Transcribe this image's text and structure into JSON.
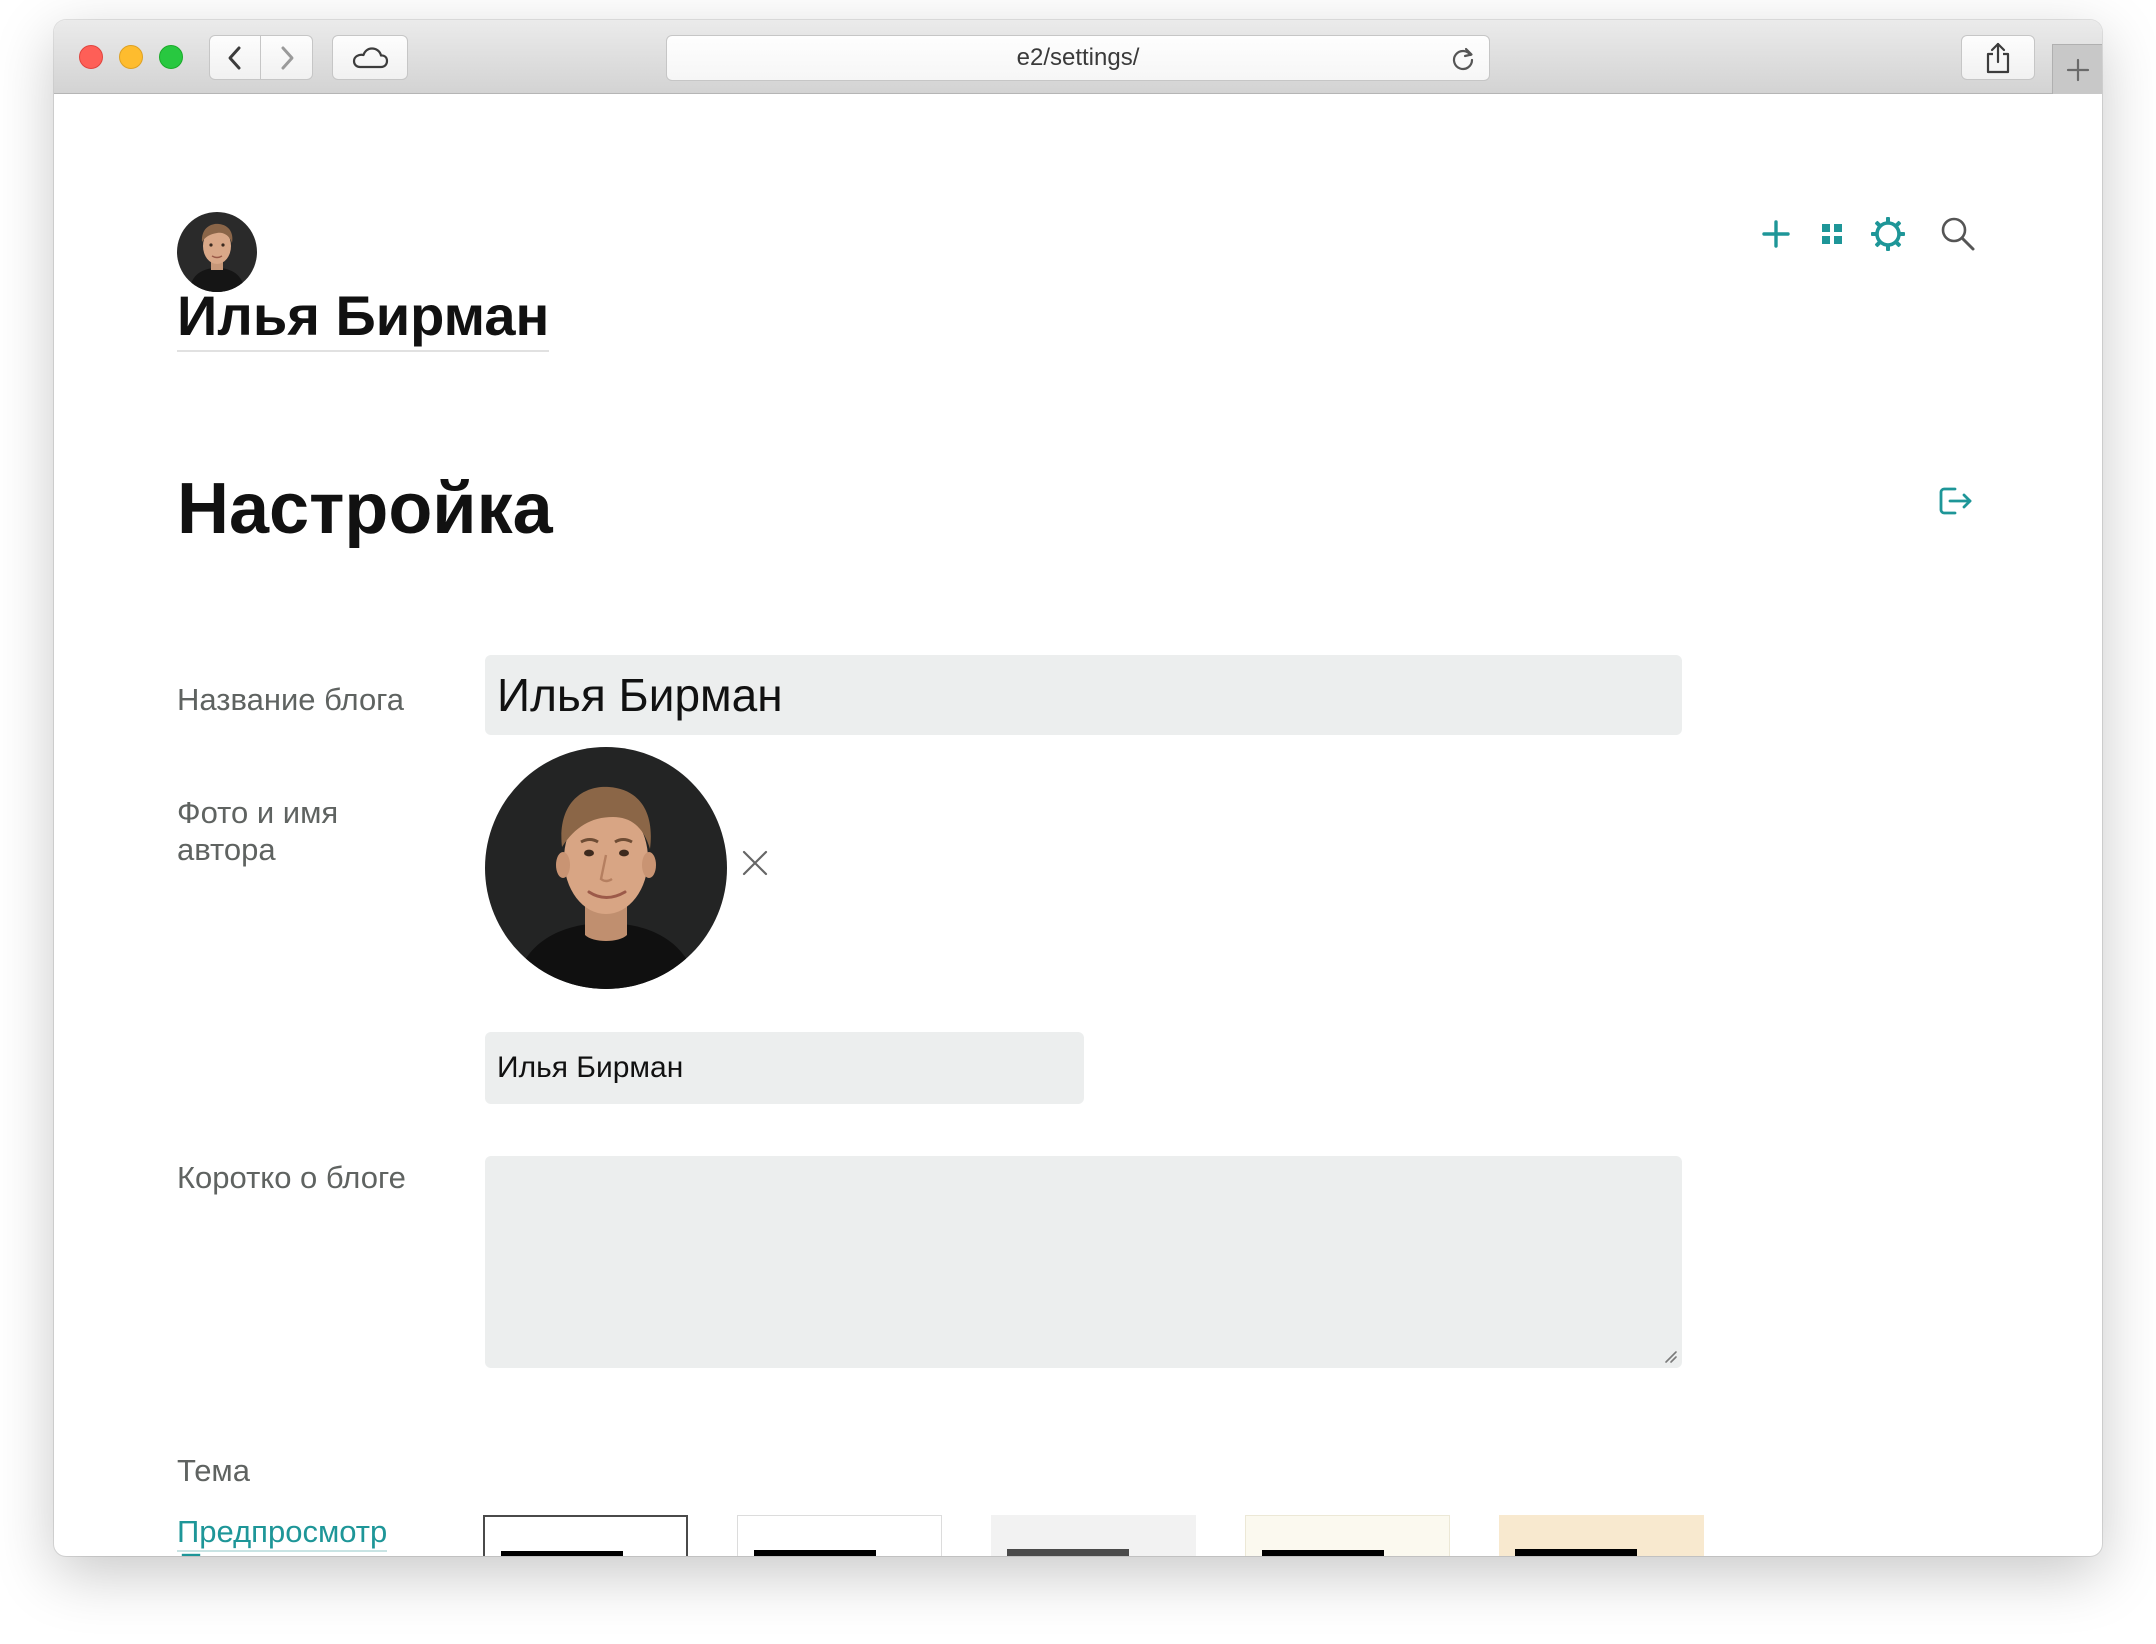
{
  "browser": {
    "url": "e2/settings/",
    "icons": {
      "back": "chevron-left-icon",
      "forward": "chevron-right-icon",
      "cloud": "cloud-icon",
      "reload": "reload-icon",
      "share": "share-icon",
      "new_tab": "plus-icon"
    }
  },
  "header": {
    "blog_title": "Илья Бирман",
    "actions": [
      "plus-icon",
      "grid-icon",
      "gear-icon",
      "search-icon"
    ],
    "accent_color": "#1e9698"
  },
  "page": {
    "title": "Настройка",
    "logout_icon": "logout-icon"
  },
  "form": {
    "blog_name": {
      "label": "Название блога",
      "value": "Илья Бирман"
    },
    "author": {
      "label_line1": "Фото и имя",
      "label_line2": "автора",
      "name_value": "Илья Бирман",
      "remove_icon": "close-icon"
    },
    "about": {
      "label": "Коротко о блоге",
      "value": ""
    },
    "theme": {
      "label": "Тема",
      "preview_link": "Предпросмотр",
      "selected_index": 0,
      "options": [
        {
          "background": "#ffffff"
        },
        {
          "background": "#ffffff"
        },
        {
          "background": "#f2f2f2"
        },
        {
          "background": "#fbf9ef"
        },
        {
          "background": "#f8e9cf"
        }
      ]
    }
  }
}
